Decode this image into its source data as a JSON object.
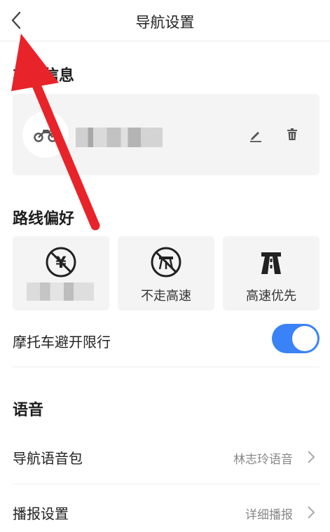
{
  "header": {
    "title": "导航设置"
  },
  "vehicle_section": {
    "title": "车辆信息",
    "plate": ""
  },
  "route_section": {
    "title": "路线偏好",
    "options": [
      {
        "label": "",
        "icon": "no-toll-icon"
      },
      {
        "label": "不走高速",
        "icon": "no-highway-icon"
      },
      {
        "label": "高速优先",
        "icon": "highway-icon"
      }
    ]
  },
  "restriction": {
    "label": "摩托车避开限行",
    "enabled": true
  },
  "voice_section": {
    "title": "语音"
  },
  "voice_pack": {
    "label": "导航语音包",
    "value": "林志玲语音"
  },
  "broadcast": {
    "label": "播报设置",
    "value": "详细播报"
  },
  "colors": {
    "accent": "#3a82f7",
    "annotation_arrow": "#e8232a"
  }
}
